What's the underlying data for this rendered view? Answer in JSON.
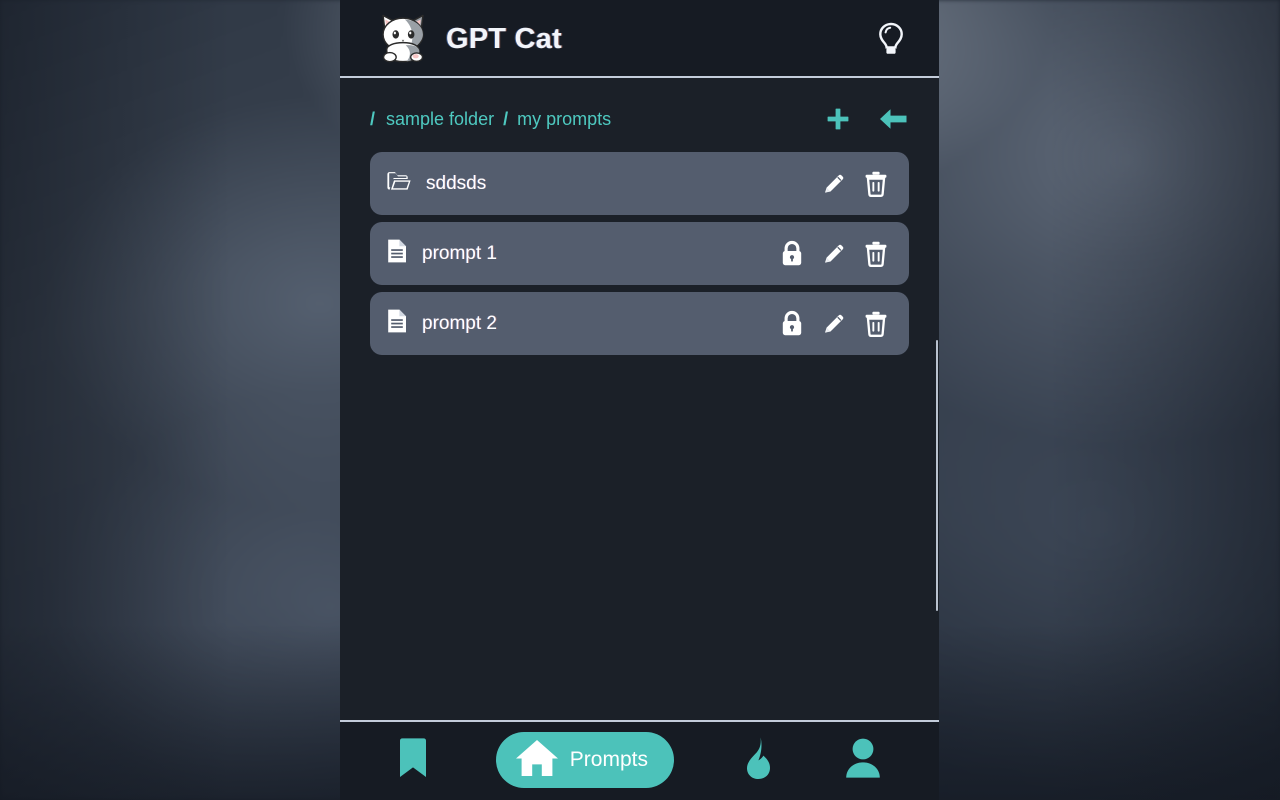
{
  "window": {
    "background_style": "blurred-dark-desktop"
  },
  "header": {
    "logo_icon": "cat-logo-icon",
    "title": "GPT Cat",
    "action_icon": "lightbulb-icon"
  },
  "breadcrumb": {
    "leading_separator": "/",
    "separator": "/",
    "items": [
      {
        "label": "sample folder"
      },
      {
        "label": "my prompts"
      }
    ],
    "actions": [
      {
        "name": "add-button",
        "icon": "plus-icon"
      },
      {
        "name": "back-button",
        "icon": "arrow-left-icon"
      }
    ]
  },
  "list": {
    "items": [
      {
        "label": "sddsds",
        "type": "folder",
        "icon": "folder-open-icon",
        "actions": [
          "edit-icon",
          "delete-icon"
        ]
      },
      {
        "label": "prompt 1",
        "type": "prompt",
        "icon": "document-icon",
        "actions": [
          "lock-icon",
          "edit-icon",
          "delete-icon"
        ]
      },
      {
        "label": "prompt 2",
        "type": "prompt",
        "icon": "document-icon",
        "actions": [
          "lock-icon",
          "edit-icon",
          "delete-icon"
        ]
      }
    ]
  },
  "bottom_nav": {
    "items": [
      {
        "label": "",
        "icon": "bookmark-icon",
        "active": false
      },
      {
        "label": "Prompts",
        "icon": "home-icon",
        "active": true
      },
      {
        "label": "",
        "icon": "flame-icon",
        "active": false
      },
      {
        "label": "",
        "icon": "person-icon",
        "active": false
      }
    ]
  },
  "colors": {
    "accent": "#4cc2ba",
    "panel_bg": "#1b2028",
    "header_bg": "#161b23",
    "row_bg": "#545d6e",
    "text": "#ffffff"
  }
}
